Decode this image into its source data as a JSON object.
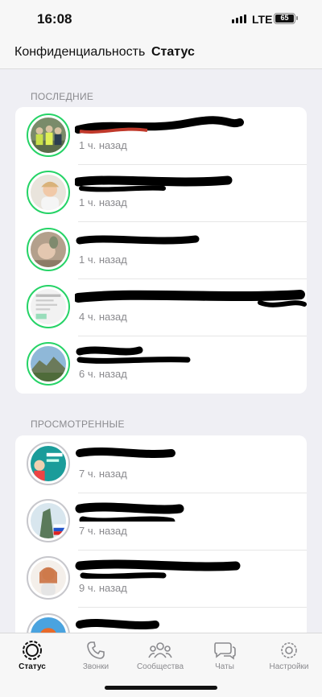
{
  "status_bar": {
    "time": "16:08",
    "network": "LTE",
    "battery": "65"
  },
  "header": {
    "back_label": "Конфиденциальность",
    "title": "Статус"
  },
  "sections": {
    "recent_label": "ПОСЛЕДНИЕ",
    "viewed_label": "ПРОСМОТРЕННЫЕ"
  },
  "recent": [
    {
      "time": "1 ч. назад",
      "avatar": "group-photo",
      "name_redacted": true
    },
    {
      "time": "1 ч. назад",
      "avatar": "child-photo",
      "name_redacted": true
    },
    {
      "time": "1 ч. назад",
      "avatar": "hands-photo",
      "name_redacted": true
    },
    {
      "time": "4 ч. назад",
      "avatar": "document-photo",
      "name_redacted": true
    },
    {
      "time": "6 ч. назад",
      "avatar": "mountain-photo",
      "name_redacted": true
    }
  ],
  "viewed": [
    {
      "time": "7 ч. назад",
      "avatar": "banner-photo",
      "name_redacted": true
    },
    {
      "time": "7 ч. назад",
      "avatar": "monument-photo",
      "name_redacted": true
    },
    {
      "time": "9 ч. назад",
      "avatar": "woman-photo",
      "name_redacted": true
    },
    {
      "time": "",
      "avatar": "cartoon-photo",
      "name_redacted": true
    }
  ],
  "tabs": [
    {
      "label": "Статус",
      "icon": "status-icon",
      "active": true
    },
    {
      "label": "Звонки",
      "icon": "phone-icon",
      "active": false
    },
    {
      "label": "Сообщества",
      "icon": "communities-icon",
      "active": false
    },
    {
      "label": "Чаты",
      "icon": "chats-icon",
      "active": false
    },
    {
      "label": "Настройки",
      "icon": "gear-icon",
      "active": false
    }
  ],
  "colors": {
    "accent": "#25d366",
    "viewed_ring": "#c7c7cc",
    "redaction": "#000000",
    "redaction_red": "#c0392b"
  }
}
